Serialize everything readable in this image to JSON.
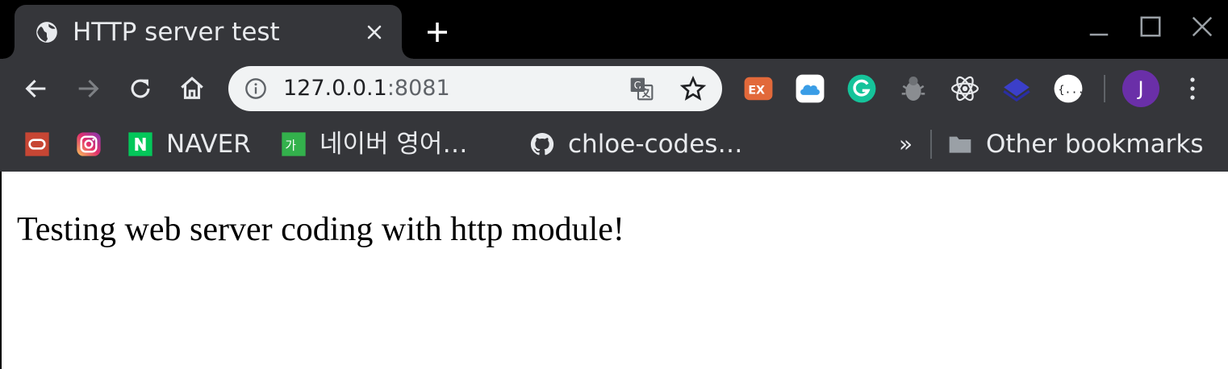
{
  "tab": {
    "title": "HTTP server test",
    "favicon": "globe-icon"
  },
  "window": {
    "controls": [
      "minimize-icon",
      "maximize-icon",
      "close-icon"
    ]
  },
  "toolbar": {
    "url_host": "127.0.0.1",
    "url_port": ":8081",
    "buttons": [
      "back-icon",
      "forward-icon",
      "reload-icon",
      "home-icon"
    ],
    "extensions": [
      "ex-extension-icon",
      "icloud-extension-icon",
      "grammarly-extension-icon",
      "bug-extension-icon",
      "react-devtools-icon",
      "layers-extension-icon",
      "json-extension-icon"
    ],
    "profile_initial": "J"
  },
  "bookmarks": {
    "items": [
      {
        "label": "",
        "icon": "oracle-icon"
      },
      {
        "label": "",
        "icon": "instagram-icon"
      },
      {
        "label": "NAVER",
        "icon": "naver-icon"
      },
      {
        "label": "네이버 영어…",
        "icon": "naver-dictionary-icon"
      },
      {
        "label": "chloe-codes…",
        "icon": "github-icon"
      }
    ],
    "overflow": "»",
    "other": "Other bookmarks"
  },
  "page": {
    "text": "Testing web server coding with http module!"
  },
  "colors": {
    "tabstrip": "#000000",
    "toolbar": "#35363a",
    "omnibox": "#f1f3f4",
    "avatar": "#6a2fa8",
    "content": "#ffffff"
  }
}
